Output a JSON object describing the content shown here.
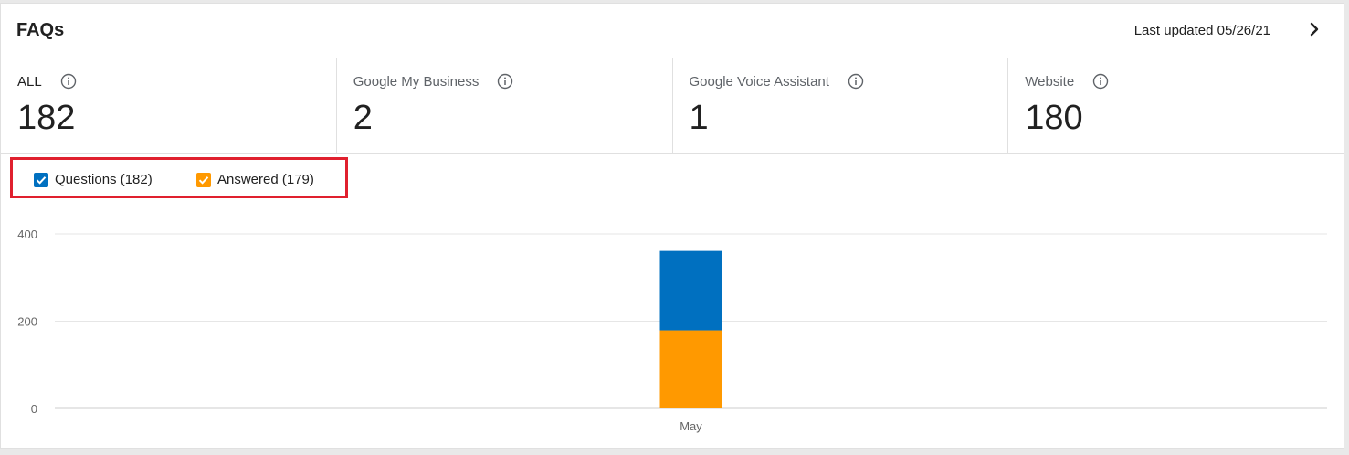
{
  "header": {
    "title": "FAQs",
    "last_updated": "Last updated 05/26/21",
    "next_icon": "chevron-right-icon"
  },
  "stats": [
    {
      "label": "ALL",
      "value": "182",
      "icon": "info-icon"
    },
    {
      "label": "Google My Business",
      "value": "2",
      "icon": "info-icon"
    },
    {
      "label": "Google Voice Assistant",
      "value": "1",
      "icon": "info-icon"
    },
    {
      "label": "Website",
      "value": "180",
      "icon": "info-icon"
    }
  ],
  "legend": {
    "questions": {
      "label": "Questions (182)",
      "checked": true,
      "color": "#0070c0"
    },
    "answered": {
      "label": "Answered (179)",
      "checked": true,
      "color": "#ff9900"
    },
    "highlight_color": "#e0202e"
  },
  "chart_data": {
    "type": "bar",
    "stacked": true,
    "categories": [
      "May"
    ],
    "series": [
      {
        "name": "Answered",
        "values": [
          179
        ],
        "color": "#ff9900"
      },
      {
        "name": "Questions",
        "values": [
          182
        ],
        "color": "#0070c0"
      }
    ],
    "yticks": [
      0,
      200,
      400
    ],
    "ylim": [
      0,
      400
    ],
    "grid": true
  }
}
